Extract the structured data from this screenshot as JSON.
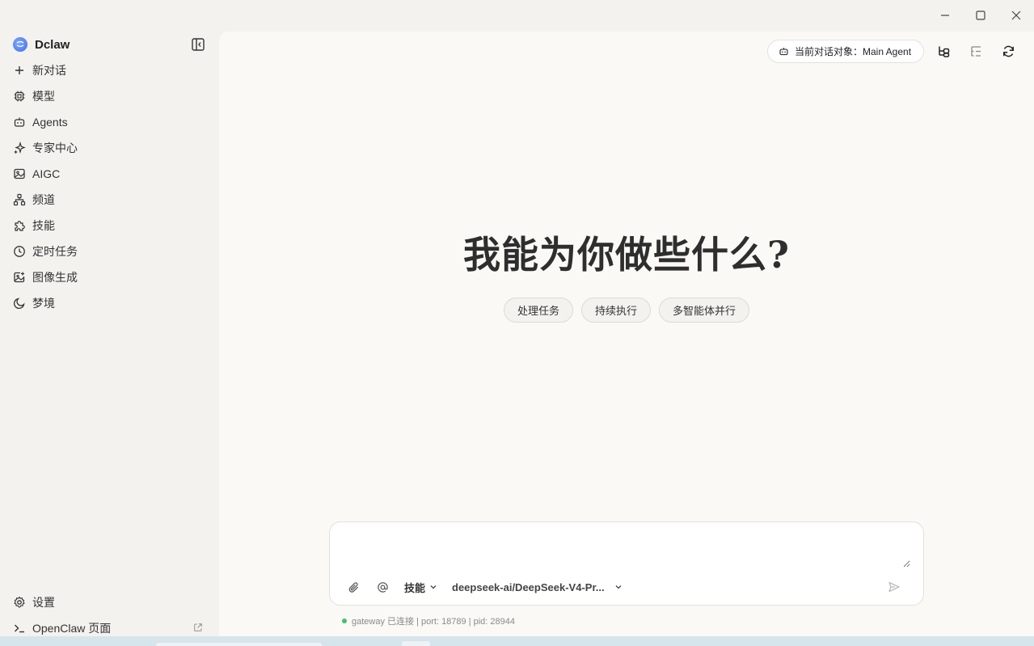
{
  "app": {
    "name": "Dclaw"
  },
  "sidebar": {
    "items": [
      {
        "label": "新对话",
        "icon": "plus-icon"
      },
      {
        "label": "模型",
        "icon": "chip-icon"
      },
      {
        "label": "Agents",
        "icon": "robot-icon"
      },
      {
        "label": "专家中心",
        "icon": "sparkles-icon"
      },
      {
        "label": "AIGC",
        "icon": "image-icon"
      },
      {
        "label": "频道",
        "icon": "network-icon"
      },
      {
        "label": "技能",
        "icon": "puzzle-icon"
      },
      {
        "label": "定时任务",
        "icon": "clock-icon"
      },
      {
        "label": "图像生成",
        "icon": "image-plus-icon"
      },
      {
        "label": "梦境",
        "icon": "moon-icon"
      }
    ],
    "bottom": [
      {
        "label": "设置",
        "icon": "gear-icon"
      },
      {
        "label": "OpenClaw 页面",
        "icon": "terminal-icon"
      }
    ]
  },
  "header": {
    "target_label": "当前对话对象：Main Agent"
  },
  "hero": {
    "title": "我能为你做些什么?"
  },
  "chips": [
    "处理任务",
    "持续执行",
    "多智能体并行"
  ],
  "composer": {
    "placeholder": "",
    "skills_label": "技能",
    "model_label": "deepseek-ai/DeepSeek-V4-Pr..."
  },
  "status": {
    "text": "gateway 已连接 | port: 18789 | pid: 28944",
    "color": "#3cc46a"
  }
}
